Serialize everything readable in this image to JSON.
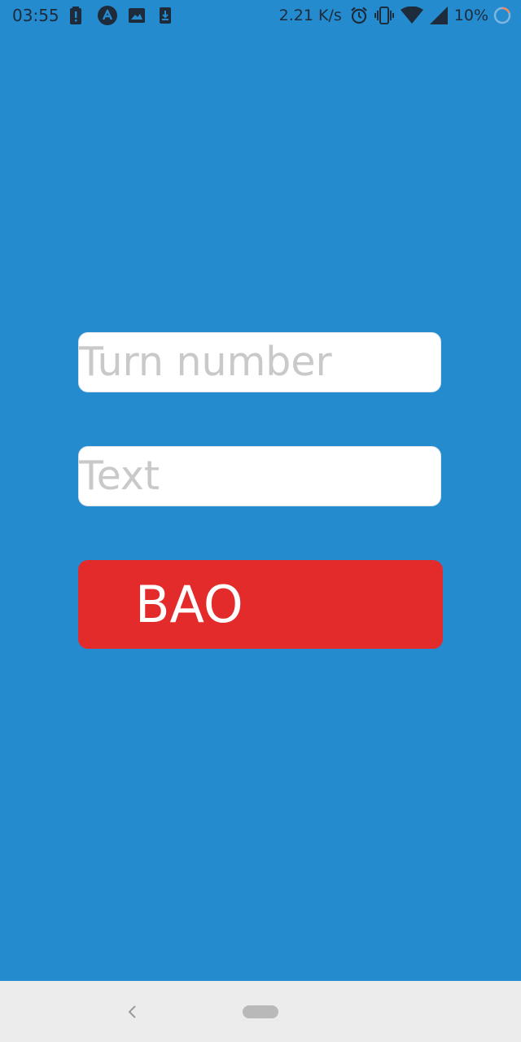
{
  "status_bar": {
    "time": "03:55",
    "network_speed": "2.21 K/s",
    "battery_percent": "10%",
    "left_icons": [
      "battery-alert-icon",
      "app-logo-icon",
      "image-icon",
      "download-icon"
    ],
    "right_icons": [
      "alarm-icon",
      "vibrate-icon",
      "wifi-icon",
      "signal-icon",
      "battery-loading-icon"
    ]
  },
  "form": {
    "turn_number": {
      "placeholder": "Turn number",
      "value": ""
    },
    "text": {
      "placeholder": "Text",
      "value": ""
    },
    "submit_label": "BAO"
  },
  "navigation": {
    "back_icon": "back-chevron-icon",
    "home_icon": "home-pill-icon"
  },
  "colors": {
    "background": "#258bcf",
    "button": "#e42b2b",
    "field": "#ffffff",
    "placeholder": "#c9c9c9",
    "nav_bar": "#ececec"
  }
}
